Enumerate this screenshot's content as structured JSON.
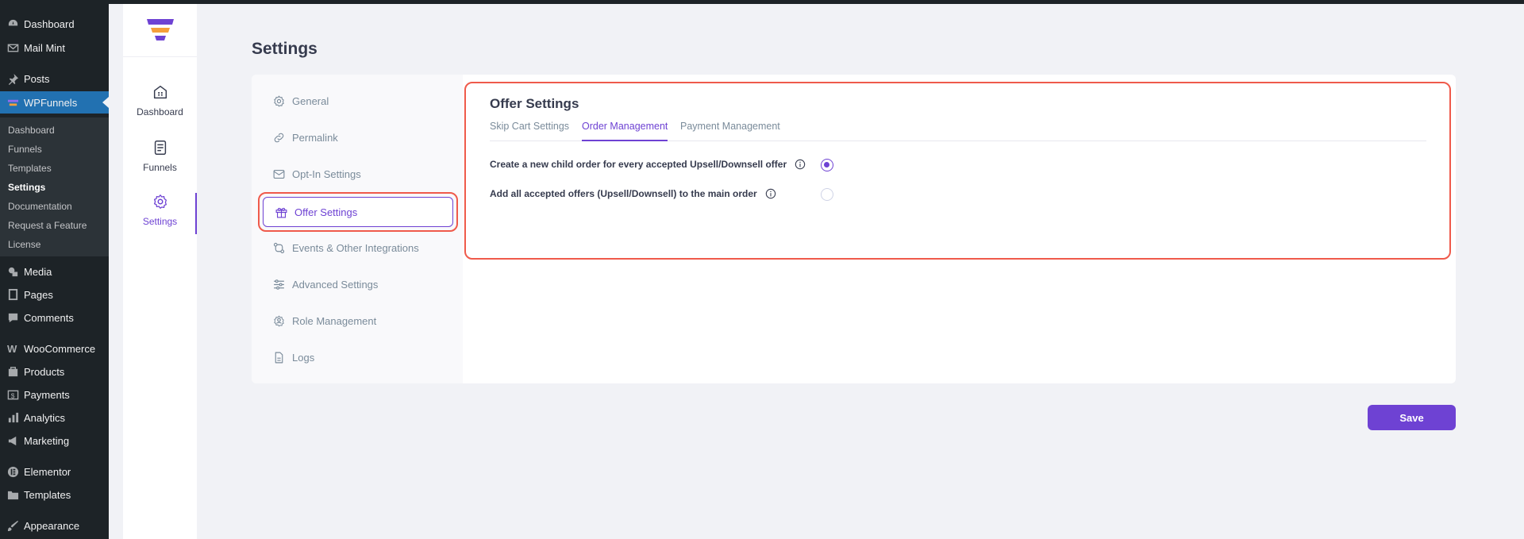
{
  "wp_menu": {
    "top": [
      {
        "label": "Dashboard",
        "icon": "dashboard-icon"
      },
      {
        "label": "Mail Mint",
        "icon": "mail-icon"
      },
      {
        "label": "Posts",
        "icon": "pin-icon"
      },
      {
        "label": "WPFunnels",
        "icon": "wpfunnels-icon"
      }
    ],
    "submenu": [
      "Dashboard",
      "Funnels",
      "Templates",
      "Settings",
      "Documentation",
      "Request a Feature",
      "License"
    ],
    "bottom": [
      {
        "label": "Media",
        "icon": "media-icon"
      },
      {
        "label": "Pages",
        "icon": "pages-icon"
      },
      {
        "label": "Comments",
        "icon": "comments-icon"
      },
      {
        "label": "WooCommerce",
        "icon": "woocommerce-icon"
      },
      {
        "label": "Products",
        "icon": "products-icon"
      },
      {
        "label": "Payments",
        "icon": "payments-icon"
      },
      {
        "label": "Analytics",
        "icon": "analytics-icon"
      },
      {
        "label": "Marketing",
        "icon": "marketing-icon"
      },
      {
        "label": "Elementor",
        "icon": "elementor-icon"
      },
      {
        "label": "Templates",
        "icon": "templates-icon"
      },
      {
        "label": "Appearance",
        "icon": "appearance-icon"
      }
    ]
  },
  "rail": {
    "items": [
      {
        "label": "Dashboard",
        "icon": "dashboard-icon"
      },
      {
        "label": "Funnels",
        "icon": "funnels-icon"
      },
      {
        "label": "Settings",
        "icon": "gear-icon"
      }
    ]
  },
  "page": {
    "title": "Settings"
  },
  "settings_nav": [
    {
      "label": "General",
      "icon": "gear-icon"
    },
    {
      "label": "Permalink",
      "icon": "link-icon"
    },
    {
      "label": "Opt-In Settings",
      "icon": "mail-icon"
    },
    {
      "label": "Offer Settings",
      "icon": "gift-icon"
    },
    {
      "label": "Events & Other Integrations",
      "icon": "integrations-icon"
    },
    {
      "label": "Advanced Settings",
      "icon": "sliders-icon"
    },
    {
      "label": "Role Management",
      "icon": "role-gear-icon"
    },
    {
      "label": "Logs",
      "icon": "file-icon"
    }
  ],
  "offer": {
    "title": "Offer Settings",
    "tabs": [
      "Skip Cart Settings",
      "Order Management",
      "Payment Management"
    ],
    "active_tab": "Order Management",
    "options": [
      {
        "label": "Create a new child order for every accepted Upsell/Downsell offer",
        "checked": true
      },
      {
        "label": "Add all accepted offers (Upsell/Downsell) to the main order",
        "checked": false
      }
    ]
  },
  "save_label": "Save",
  "colors": {
    "accent": "#6e42d3",
    "highlight": "#ef5a4b",
    "wp_sidebar": "#1d2327",
    "wp_active": "#2271b1"
  }
}
